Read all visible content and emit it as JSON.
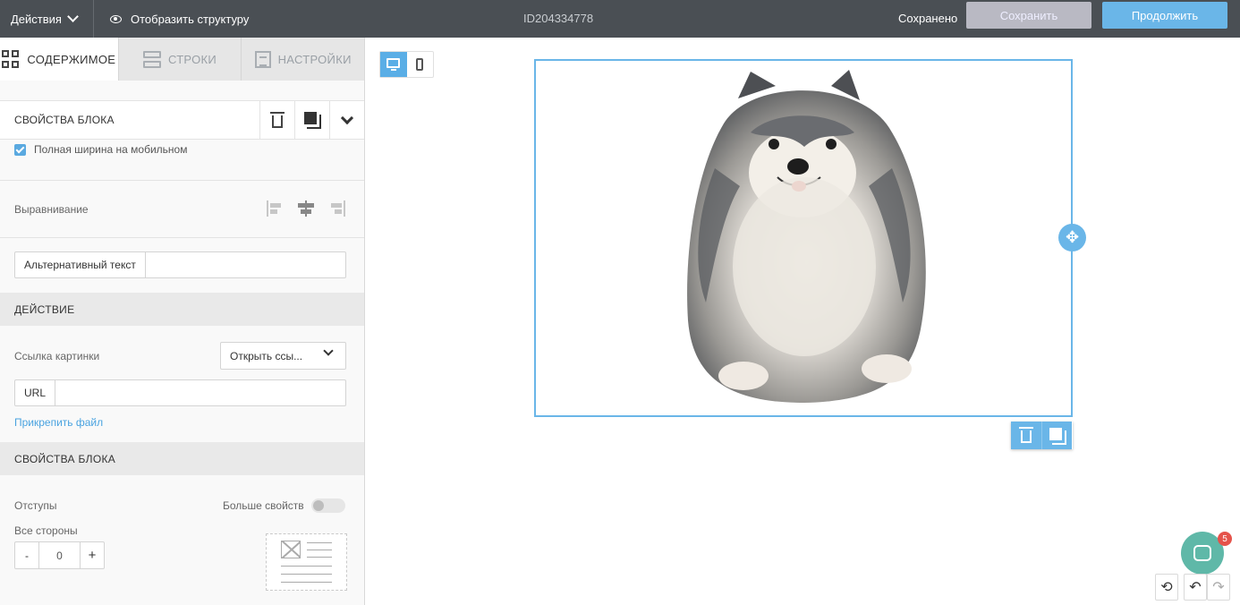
{
  "topbar": {
    "actions_label": "Действия",
    "structure_label": "Отобразить структуру",
    "doc_id": "ID204334778",
    "status": "Сохранено",
    "save_label": "Сохранить",
    "continue_label": "Продолжить"
  },
  "tabs": [
    {
      "label": "СОДЕРЖИМОЕ",
      "active": true
    },
    {
      "label": "СТРОКИ",
      "active": false
    },
    {
      "label": "НАСТРОЙКИ",
      "active": false
    }
  ],
  "block": {
    "title": "СВОЙСТВА БЛОКА",
    "full_width_mobile": "Полная ширина на мобильном",
    "full_width_checked": true,
    "alignment_label": "Выравнивание",
    "alignment_value": "center",
    "alt_text_label": "Альтернативный текст",
    "alt_text_value": ""
  },
  "action": {
    "title": "ДЕЙСТВИЕ",
    "image_link_label": "Ссылка картинки",
    "image_link_value": "Открыть ссы...",
    "url_label": "URL",
    "url_value": "",
    "attach_file": "Прикрепить файл"
  },
  "block_props": {
    "title": "СВОЙСТВА БЛОКА",
    "padding_label": "Отступы",
    "more_props_label": "Больше свойств",
    "more_props_on": false,
    "all_sides_label": "Все стороны",
    "minus": "-",
    "padding_value": "0",
    "plus": "+"
  },
  "chat": {
    "badge": "5"
  },
  "colors": {
    "topbar": "#4a4f54",
    "accent": "#6ab6e8",
    "save_disabled": "#b9b9c3",
    "chat": "#5fb8a8",
    "badge": "#e5534b"
  }
}
